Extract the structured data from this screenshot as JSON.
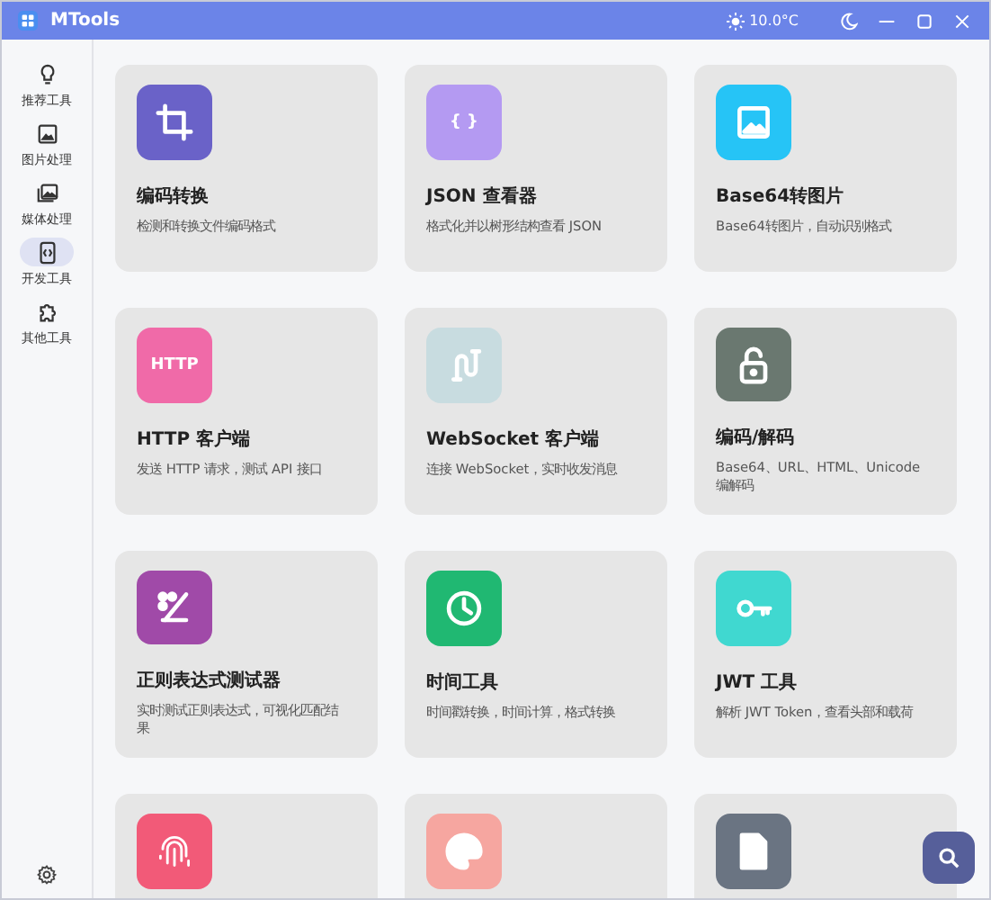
{
  "window": {
    "title": "MTools",
    "temperature": "10.0°C"
  },
  "sidebar": {
    "items": [
      {
        "label": "推荐工具",
        "kind": "bulb",
        "selected": false
      },
      {
        "label": "图片处理",
        "kind": "image",
        "selected": false
      },
      {
        "label": "媒体处理",
        "kind": "gallery",
        "selected": false
      },
      {
        "label": "开发工具",
        "kind": "code",
        "selected": true
      },
      {
        "label": "其他工具",
        "kind": "puzzle",
        "selected": false
      }
    ]
  },
  "tools": [
    {
      "title": "编码转换",
      "description": "检测和转换文件编码格式",
      "kind": "crop",
      "color": "#6a62c8"
    },
    {
      "title": "JSON 查看器",
      "description": "格式化并以树形结构查看 JSON",
      "kind": "text",
      "icon_text": "{ }",
      "color": "#b49af2"
    },
    {
      "title": "Base64转图片",
      "description": "Base64转图片，自动识别格式",
      "kind": "image",
      "color": "#26c4f6"
    },
    {
      "title": "HTTP 客户端",
      "description": "发送 HTTP 请求，测试 API 接口",
      "kind": "text",
      "icon_text": "HTTP",
      "color": "#f06aa8"
    },
    {
      "title": "WebSocket 客户端",
      "description": "连接 WebSocket，实时收发消息",
      "kind": "plug",
      "color": "#c8dce0"
    },
    {
      "title": "编码/解码",
      "description": "Base64、URL、HTML、Unicode 编解码",
      "kind": "lock",
      "color": "#6a7870"
    },
    {
      "title": "正则表达式测试器",
      "description": "实时测试正则表达式，可视化匹配结果",
      "kind": "regex",
      "color": "#a04aa8"
    },
    {
      "title": "时间工具",
      "description": "时间戳转换，时间计算，格式转换",
      "kind": "clock",
      "color": "#20b872"
    },
    {
      "title": "JWT 工具",
      "description": "解析 JWT Token，查看头部和载荷",
      "kind": "key",
      "color": "#40d8d0"
    },
    {
      "kind": "fingerprint",
      "color": "#f25a78"
    },
    {
      "kind": "palette",
      "color": "#f6a6a0"
    },
    {
      "kind": "document",
      "color": "#6a7482"
    }
  ]
}
